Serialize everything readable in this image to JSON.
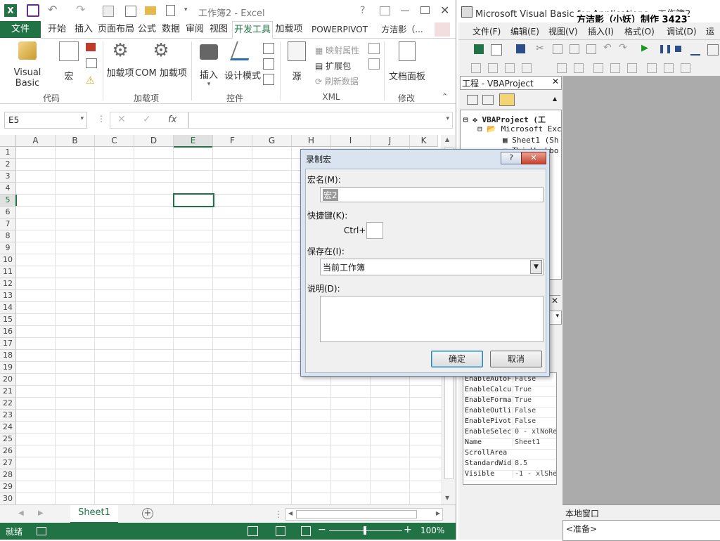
{
  "excel": {
    "title": "工作簿2 - Excel",
    "help": "?",
    "file_tab": "文件",
    "tabs": [
      "开始",
      "插入",
      "页面布局",
      "公式",
      "数据",
      "审阅",
      "视图",
      "开发工具",
      "加载项",
      "POWERPIVOT",
      "方洁影（..."
    ],
    "ribbon": {
      "visual_basic": "Visual Basic",
      "macro": "宏",
      "addins": "加载项",
      "com_addins": "COM 加载项",
      "insert": "插入",
      "design_mode": "设计模式",
      "source": "源",
      "map_props": "映射属性",
      "expansion": "扩展包",
      "refresh": "刷新数据",
      "doc_panel": "文档面板",
      "groups": [
        "代码",
        "加载项",
        "控件",
        "XML",
        "修改"
      ]
    },
    "name_box": "E5",
    "fx": "fx",
    "columns": [
      "A",
      "B",
      "C",
      "D",
      "E",
      "F",
      "G",
      "H",
      "I",
      "J",
      "K"
    ],
    "rows": [
      "1",
      "2",
      "3",
      "4",
      "5",
      "6",
      "7",
      "8",
      "9",
      "10",
      "11",
      "12",
      "13",
      "14",
      "15",
      "16",
      "17",
      "18",
      "19",
      "20",
      "21",
      "22",
      "23",
      "24",
      "25",
      "26",
      "27",
      "28",
      "29",
      "30"
    ],
    "sheet_tab": "Sheet1",
    "status_ready": "就绪",
    "zoom": "100%",
    "accent": "#217346"
  },
  "vba": {
    "title": "Microsoft Visual Basic for Applications - 工作簿2",
    "overlay": "方洁影（小妖）制作 3423",
    "menu": [
      "文件(F)",
      "编辑(E)",
      "视图(V)",
      "插入(I)",
      "格式(O)",
      "调试(D)",
      "运行"
    ],
    "project_title": "工程 - VBAProject",
    "tree": [
      "VBAProject (工",
      "Microsoft Exc",
      "Sheet1 (Sh",
      "ThisWorkbo"
    ],
    "props": [
      [
        "EnableAutoF",
        "False"
      ],
      [
        "EnableCalcu",
        "True"
      ],
      [
        "EnableForma",
        "True"
      ],
      [
        "EnableOutli",
        "False"
      ],
      [
        "EnablePivot",
        "False"
      ],
      [
        "EnableSelec",
        "0 - xlNoRe"
      ],
      [
        "Name",
        "Sheet1"
      ],
      [
        "ScrollArea",
        ""
      ],
      [
        "StandardWid",
        "8.5"
      ],
      [
        "Visible",
        "-1 - xlShe"
      ]
    ],
    "locals_title": "本地窗口",
    "locals_status": "<准备>"
  },
  "dialog": {
    "title": "录制宏",
    "help": "?",
    "macro_name_label": "宏名(M):",
    "macro_name_value": "宏2",
    "shortcut_label": "快捷键(K):",
    "ctrl_label": "Ctrl+",
    "save_in_label": "保存在(I):",
    "save_in_value": "当前工作簿",
    "desc_label": "说明(D):",
    "ok": "确定",
    "cancel": "取消"
  }
}
